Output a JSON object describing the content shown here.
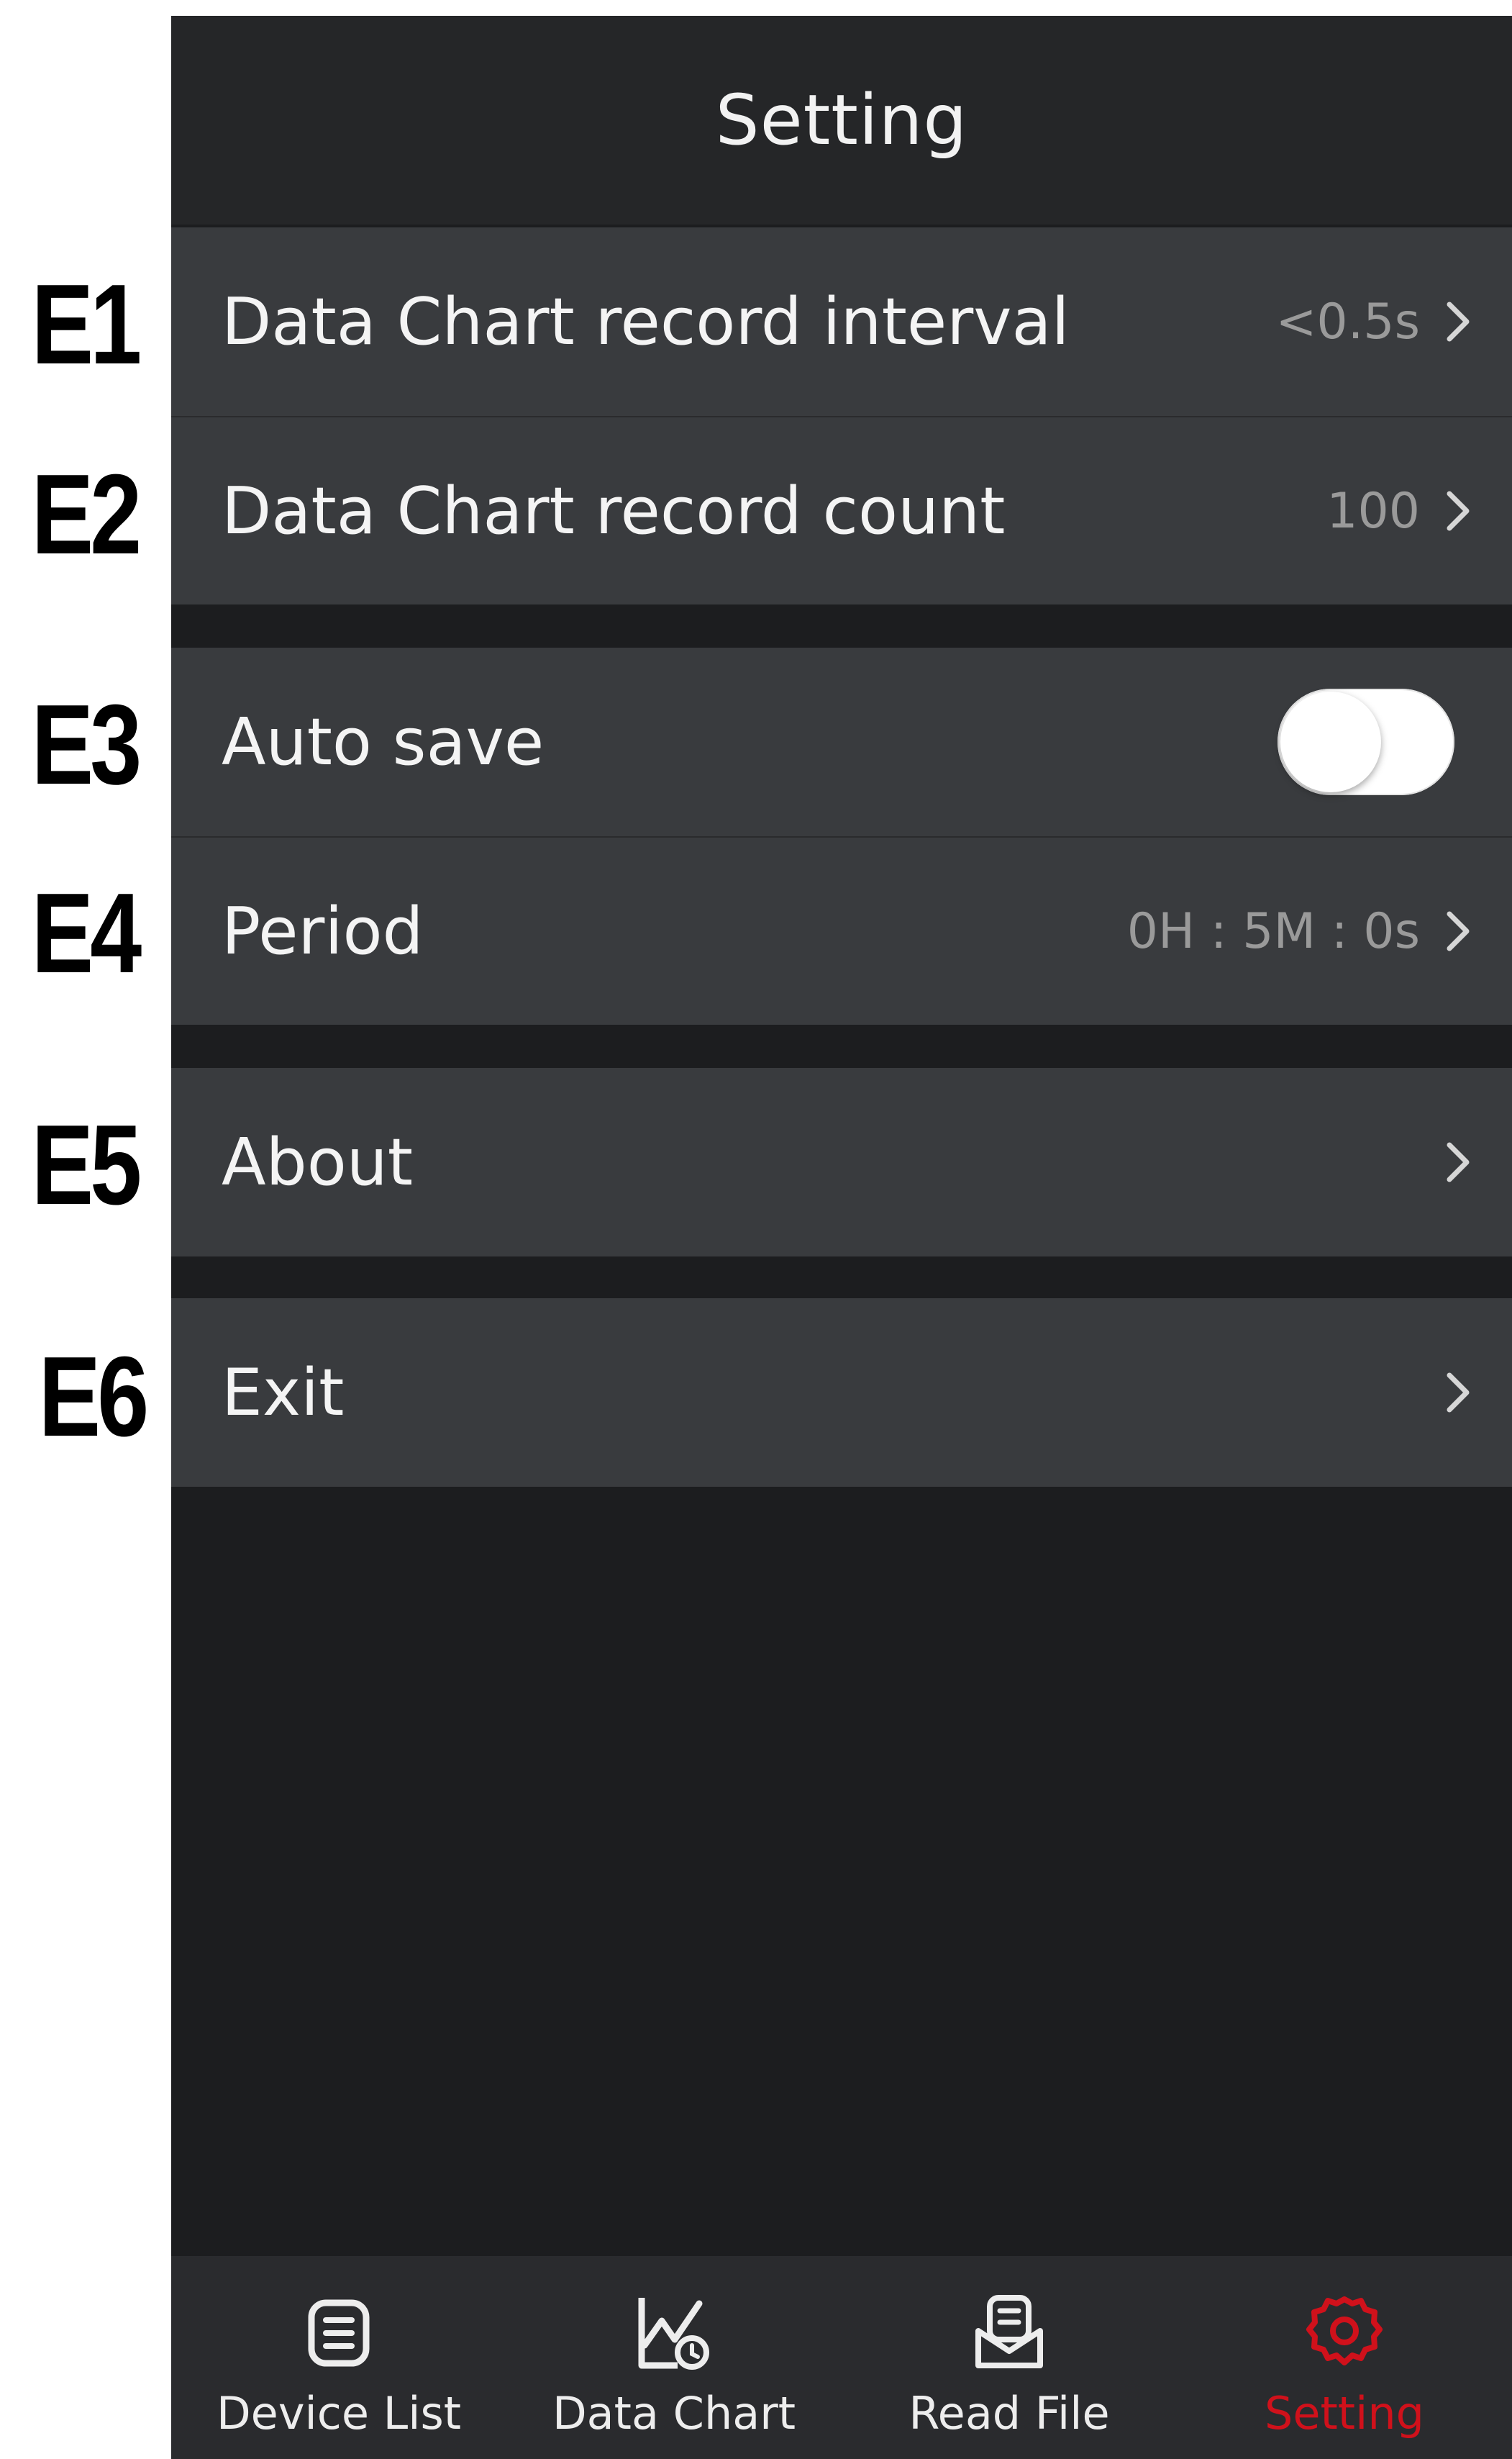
{
  "callouts": [
    "E1",
    "E2",
    "E3",
    "E4",
    "E5",
    "E6"
  ],
  "header": {
    "title": "Setting"
  },
  "rows": [
    {
      "label": "Data Chart record interval",
      "value": "<0.5s"
    },
    {
      "label": "Data Chart record count",
      "value": "100"
    },
    {
      "label": "Auto save",
      "toggle": false
    },
    {
      "label": "Period",
      "value": "0H : 5M : 0s"
    },
    {
      "label": "About"
    },
    {
      "label": "Exit"
    }
  ],
  "tabs": [
    {
      "label": "Device List",
      "icon": "list-icon",
      "active": false
    },
    {
      "label": "Data Chart",
      "icon": "chart-clock-icon",
      "active": false
    },
    {
      "label": "Read File",
      "icon": "read-file-icon",
      "active": false
    },
    {
      "label": "Setting",
      "icon": "gear-icon",
      "active": true
    }
  ],
  "colors": {
    "accent": "#d0111b",
    "background": "#1c1d1f",
    "row": "#393b3e",
    "header": "#252628"
  }
}
